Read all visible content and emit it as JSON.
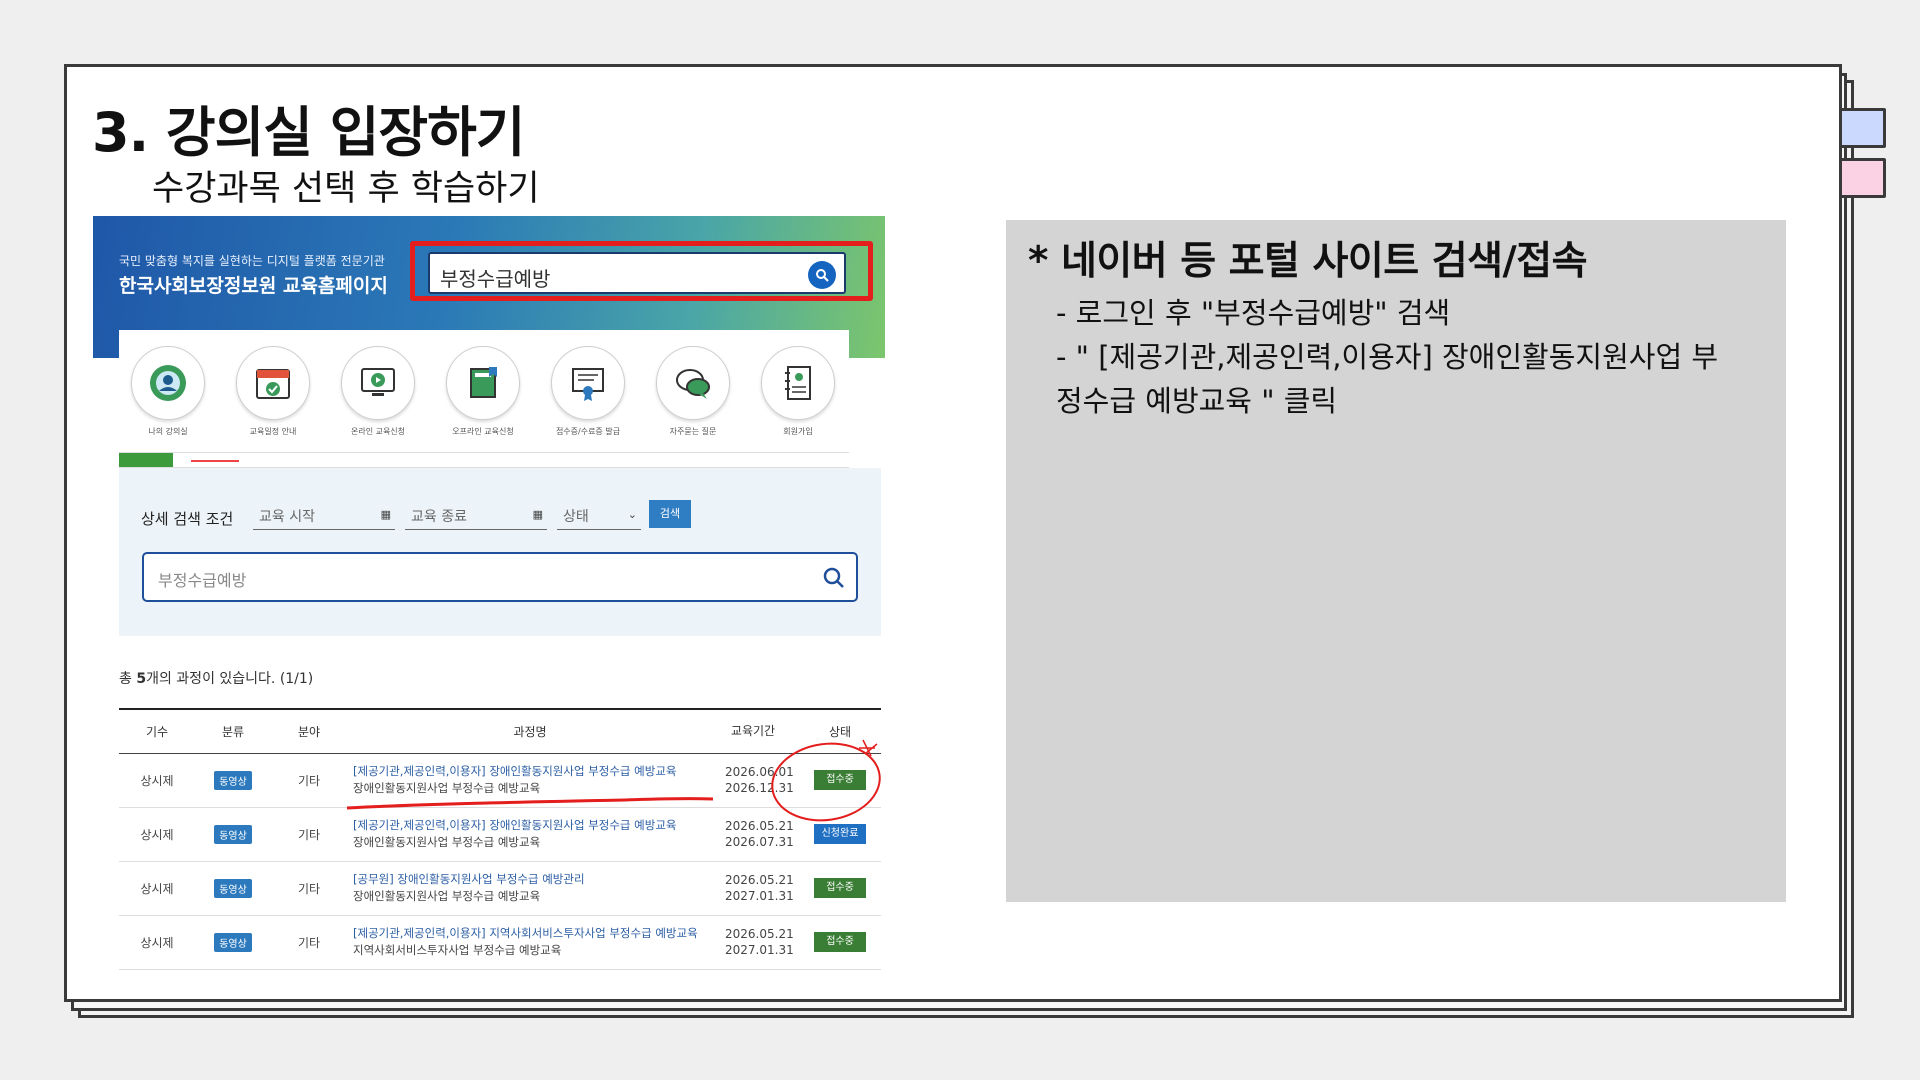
{
  "slide": {
    "title": "3. 강의실 입장하기",
    "subtitle": "수강과목 선택 후 학습하기"
  },
  "site": {
    "banner_tagline": "국민 맞춤형 복지를 실현하는 디지털 플랫폼 전문기관",
    "banner_title": "한국사회보장정보원 교육홈페이지",
    "search_value": "부정수급예방",
    "menu": [
      {
        "icon": "user-circle-icon",
        "label": "나의 강의실"
      },
      {
        "icon": "calendar-check-icon",
        "label": "교육일정 안내"
      },
      {
        "icon": "monitor-play-icon",
        "label": "온라인 교육신청"
      },
      {
        "icon": "book-icon",
        "label": "오프라인 교육신청"
      },
      {
        "icon": "certificate-icon",
        "label": "접수증/수료증 발급"
      },
      {
        "icon": "chat-bubble-icon",
        "label": "자주묻는 질문"
      },
      {
        "icon": "id-card-icon",
        "label": "회원가입"
      }
    ],
    "filter": {
      "label": "상세 검색 조건",
      "start_placeholder": "교육 시작",
      "end_placeholder": "교육 종료",
      "status_placeholder": "상태",
      "search_button": "검색",
      "keyword": "부정수급예방"
    },
    "result_count": {
      "prefix": "총 ",
      "number": "5",
      "suffix": "개의 과정이 있습니다. (1/1)"
    },
    "table": {
      "headers": [
        "기수",
        "분류",
        "분야",
        "과정명",
        "교육기간",
        "상태"
      ],
      "rows": [
        {
          "gisu": "상시제",
          "category": "동영상",
          "field": "기타",
          "title": "[제공기관,제공인력,이용자] 장애인활동지원사업 부정수급 예방교육",
          "subtitle": "장애인활동지원사업 부정수급 예방교육",
          "start": "2026.06.01",
          "end": "2026.12.31",
          "status": "접수중",
          "status_color": "#3a7d34"
        },
        {
          "gisu": "상시제",
          "category": "동영상",
          "field": "기타",
          "title": "[제공기관,제공인력,이용자] 장애인활동지원사업 부정수급 예방교육",
          "subtitle": "장애인활동지원사업 부정수급 예방교육",
          "start": "2026.05.21",
          "end": "2026.07.31",
          "status": "신청완료",
          "status_color": "#1f6fc3"
        },
        {
          "gisu": "상시제",
          "category": "동영상",
          "field": "기타",
          "title": "[공무원] 장애인활동지원사업 부정수급 예방관리",
          "subtitle": "장애인활동지원사업 부정수급 예방교육",
          "start": "2026.05.21",
          "end": "2027.01.31",
          "status": "접수중",
          "status_color": "#3a7d34"
        },
        {
          "gisu": "상시제",
          "category": "동영상",
          "field": "기타",
          "title": "[제공기관,제공인력,이용자] 지역사회서비스투자사업 부정수급 예방교육",
          "subtitle": "지역사회서비스투자사업 부정수급 예방교육",
          "start": "2026.05.21",
          "end": "2027.01.31",
          "status": "접수중",
          "status_color": "#3a7d34"
        }
      ]
    }
  },
  "note": {
    "heading": "* 네이버 등 포털 사이트 검색/접속",
    "line1": "- 로그인 후 \"부정수급예방\" 검색",
    "line2": "- \" [제공기관,제공인력,이용자] 장애인활동지원사업 부",
    "line3": "정수급 예방교육 \" 클릭"
  },
  "colors": {
    "highlight": "#e41d1d",
    "accent_blue": "#1565c0",
    "status_green": "#3a7d34"
  }
}
